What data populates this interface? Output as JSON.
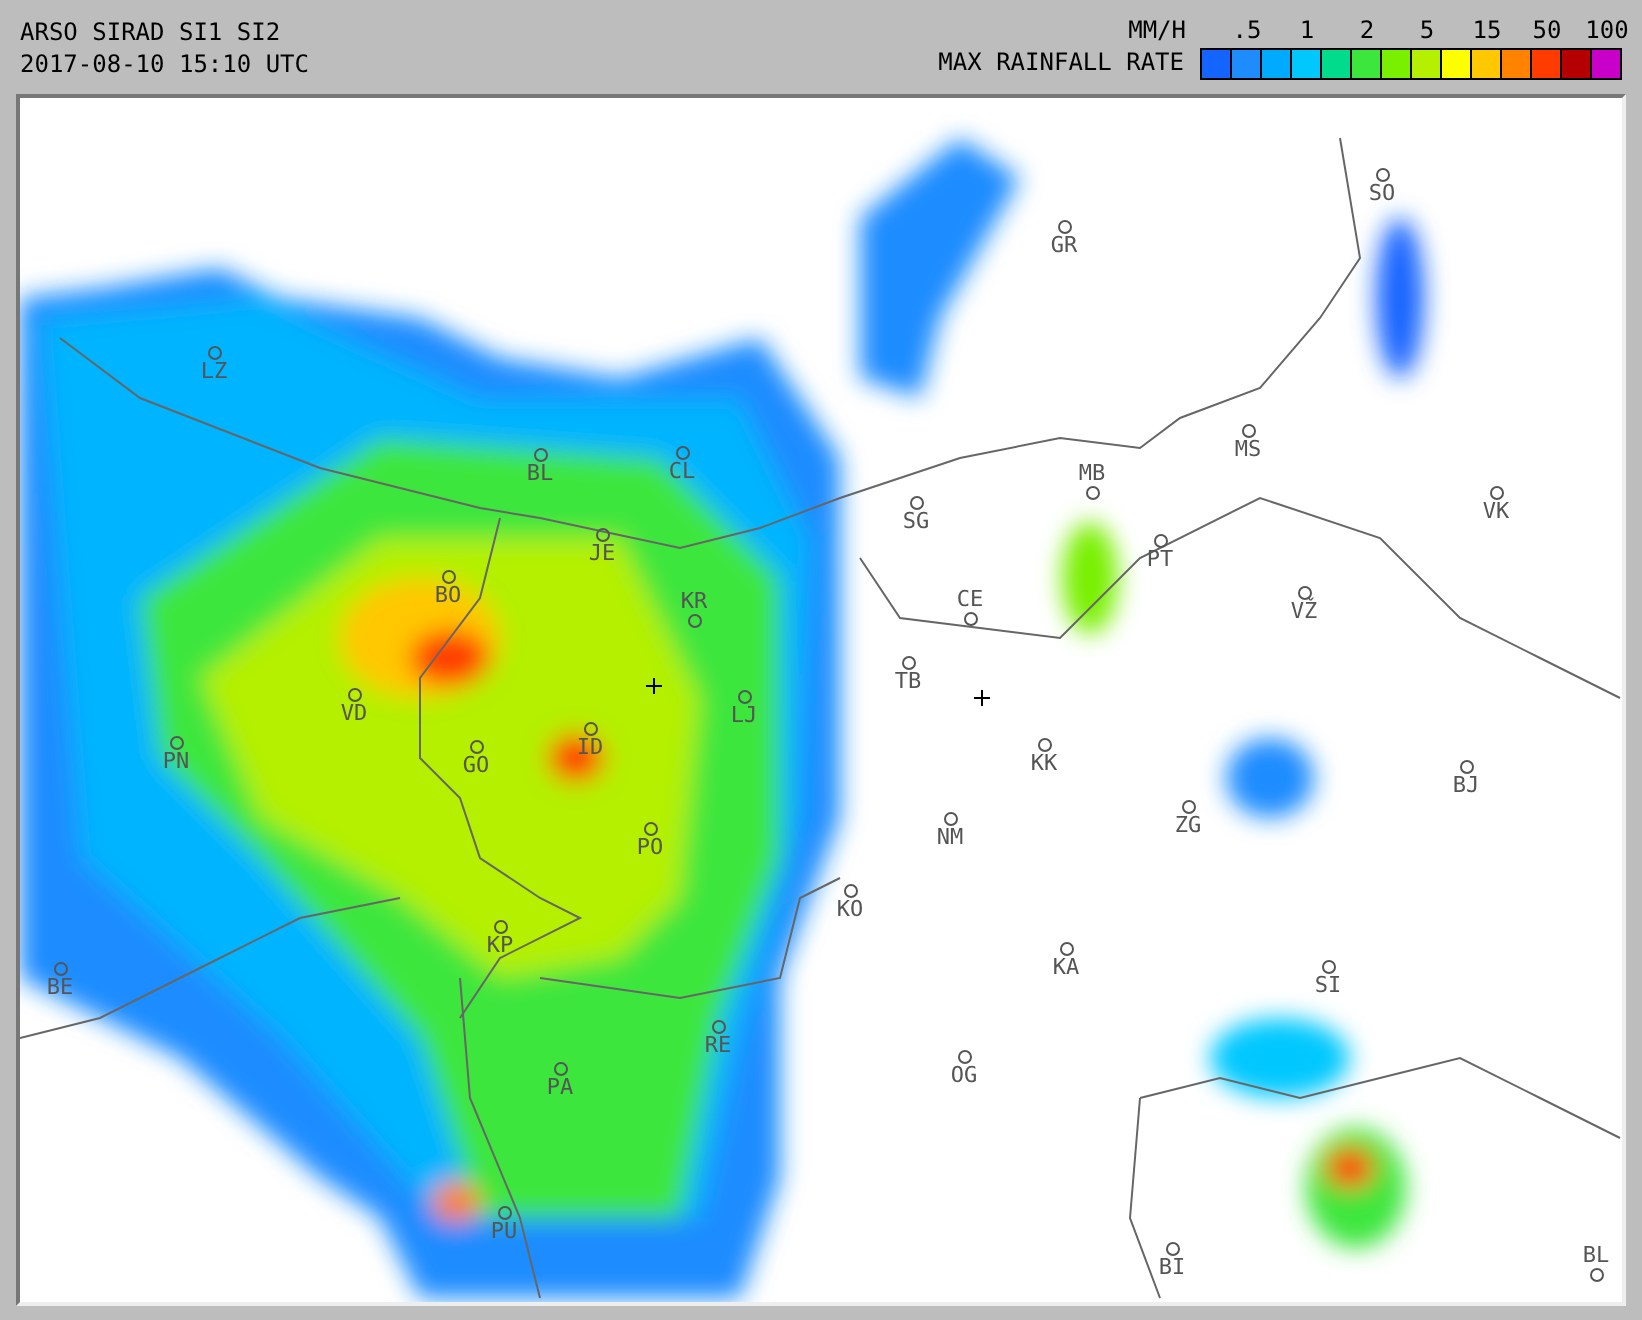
{
  "header": {
    "title": "ARSO SIRAD SI1 SI2",
    "timestamp": "2017-08-10 15:10 UTC"
  },
  "legend": {
    "unit": "MM/H",
    "title": "MAX RAINFALL RATE",
    "ticks": [
      ".5",
      "1",
      "2",
      "5",
      "15",
      "50",
      "100"
    ],
    "colors": [
      {
        "color": "#1464ff"
      },
      {
        "color": "#1e8cff"
      },
      {
        "color": "#00aaff"
      },
      {
        "color": "#00c8ff"
      },
      {
        "color": "#00dc8c"
      },
      {
        "color": "#3ce63c"
      },
      {
        "color": "#78f000"
      },
      {
        "color": "#b4f000"
      },
      {
        "color": "#ffff00"
      },
      {
        "color": "#ffc800"
      },
      {
        "color": "#ff8200"
      },
      {
        "color": "#ff3c00"
      },
      {
        "color": "#b40000"
      },
      {
        "color": "#c800c8"
      }
    ]
  },
  "map": {
    "places": [
      {
        "label": "LZ"
      },
      {
        "label": "BL"
      },
      {
        "label": "CL"
      },
      {
        "label": "JE"
      },
      {
        "label": "BO"
      },
      {
        "label": "KR"
      },
      {
        "label": "VD"
      },
      {
        "label": "PN"
      },
      {
        "label": "GO"
      },
      {
        "label": "ID"
      },
      {
        "label": "LJ"
      },
      {
        "label": "PO"
      },
      {
        "label": "KP"
      },
      {
        "label": "BE"
      },
      {
        "label": "RE"
      },
      {
        "label": "PA"
      },
      {
        "label": "PU"
      },
      {
        "label": "GR"
      },
      {
        "label": "SO"
      },
      {
        "label": "MS"
      },
      {
        "label": "MB"
      },
      {
        "label": "SG"
      },
      {
        "label": "PT"
      },
      {
        "label": "CE"
      },
      {
        "label": "VK"
      },
      {
        "label": "TB"
      },
      {
        "label": "VŽ"
      },
      {
        "label": "KK"
      },
      {
        "label": "NM"
      },
      {
        "label": "ZG"
      },
      {
        "label": "BJ"
      },
      {
        "label": "KO"
      },
      {
        "label": "KA"
      },
      {
        "label": "SI"
      },
      {
        "label": "OG"
      },
      {
        "label": "BI"
      },
      {
        "label": "BL"
      }
    ]
  }
}
